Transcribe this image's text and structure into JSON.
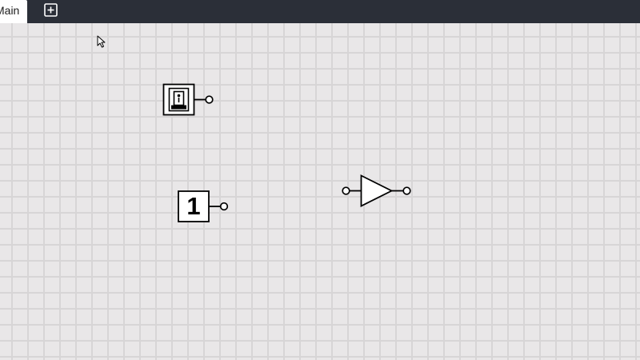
{
  "tabs": [
    {
      "label": "Main",
      "active": true
    }
  ],
  "toolbar": {
    "add_tab_icon": "plus-square-icon"
  },
  "canvas": {
    "background": "#e9e7e8",
    "grid_color": "#d7d5d6",
    "components": [
      {
        "type": "toggle-switch-input",
        "icon": "switch-icon"
      },
      {
        "type": "constant",
        "value": "1",
        "icon": "constant-one-icon"
      },
      {
        "type": "buffer",
        "icon": "buffer-gate-icon"
      }
    ]
  },
  "colors": {
    "tabbar": "#2b2f38",
    "tab_active": "#ffffff",
    "stroke": "#000000"
  }
}
